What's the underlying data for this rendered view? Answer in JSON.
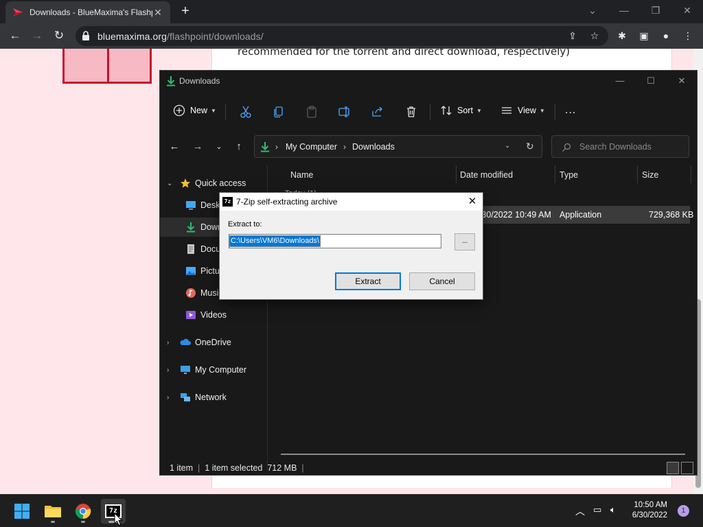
{
  "browser": {
    "tab_title": "Downloads - BlueMaxima's Flashpoint",
    "url_host": "bluemaxima.org",
    "url_path": "/flashpoint/downloads/",
    "page_text": "recommended for the torrent and direct download, respectively)"
  },
  "explorer": {
    "title": "Downloads",
    "toolbar": {
      "new_label": "New",
      "sort_label": "Sort",
      "view_label": "View",
      "more_label": "..."
    },
    "breadcrumb": [
      "My Computer",
      "Downloads"
    ],
    "search_placeholder": "Search Downloads",
    "nav": {
      "quick_access": "Quick access",
      "desktop": "Desktop",
      "downloads": "Downloads",
      "documents": "Documents",
      "pictures": "Pictures",
      "music": "Music",
      "videos": "Videos",
      "onedrive": "OneDrive",
      "my_computer": "My Computer",
      "network": "Network"
    },
    "columns": {
      "name": "Name",
      "date": "Date modified",
      "type": "Type",
      "size": "Size"
    },
    "group_header": "Today (1)",
    "file": {
      "date": "6/30/2022 10:49 AM",
      "type": "Application",
      "size": "729,368 KB"
    },
    "status": {
      "count": "1 item",
      "selected": "1 item selected",
      "size": "712 MB"
    }
  },
  "dialog": {
    "title": "7-Zip self-extracting archive",
    "icon_text": "7z",
    "close_glyph": "✕",
    "extract_label": "Extract to:",
    "path_value": "C:\\Users\\VM6\\Downloads\\",
    "browse_label": "...",
    "extract_button": "Extract",
    "cancel_button": "Cancel"
  },
  "taskbar": {
    "time": "10:50 AM",
    "date": "6/30/2022",
    "notification_count": "1"
  },
  "colors": {
    "accent": "#0078d7",
    "explorer_bg": "#191919",
    "page_bg": "#ffe6ea",
    "brand_red": "#c8102e",
    "downloads_green": "#2dbf6e"
  }
}
